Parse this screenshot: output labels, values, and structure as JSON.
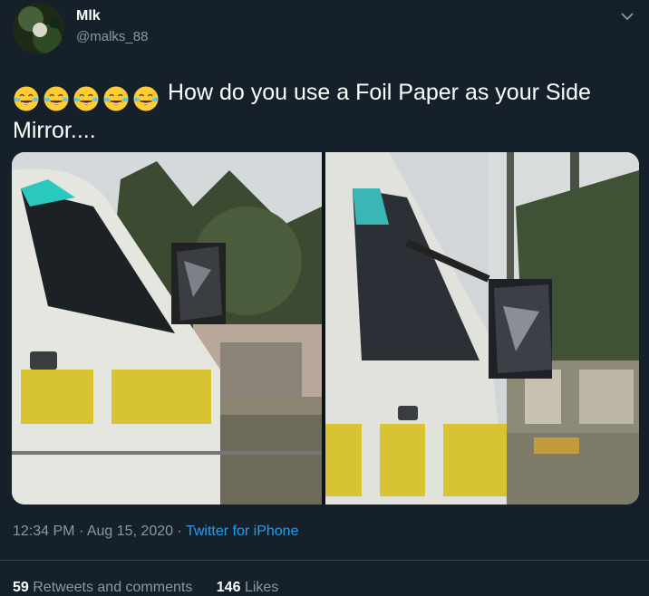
{
  "tweet": {
    "author": {
      "display_name": "Mlk",
      "handle": "@malks_88"
    },
    "text": {
      "emojis": [
        "face-with-tears-of-joy",
        "face-with-tears-of-joy",
        "face-with-tears-of-joy",
        "face-with-tears-of-joy",
        "face-with-tears-of-joy"
      ],
      "body": "How do you use a Foil Paper as your Side Mirror...."
    },
    "media": {
      "count": 2
    },
    "meta": {
      "time": "12:34 PM",
      "separator": "·",
      "date": "Aug 15, 2020",
      "source": "Twitter for iPhone"
    },
    "stats": {
      "retweets_count": "59",
      "retweets_label": "Retweets and comments",
      "likes_count": "146",
      "likes_label": "Likes"
    }
  },
  "colors": {
    "background": "#15202b",
    "secondary_text": "#8899a6",
    "link": "#1da1f2",
    "divider": "#38444d"
  }
}
